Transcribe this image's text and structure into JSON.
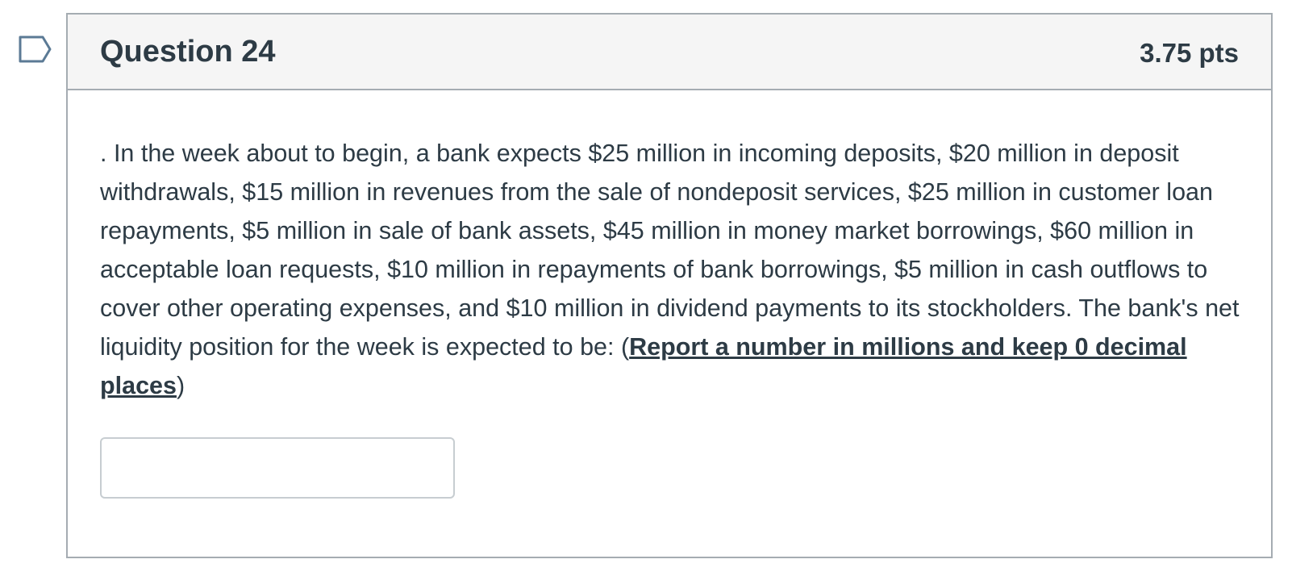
{
  "question": {
    "title": "Question 24",
    "points": "3.75 pts",
    "text_before": ". In the week about to begin, a bank expects $25 million in incoming deposits, $20 million in deposit withdrawals, $15 million in revenues from the sale of nondeposit services, $25 million in customer loan repayments, $5 million in sale of bank assets, $45 million in money market borrowings, $60 million in acceptable loan requests, $10 million in repayments of bank borrowings, $5 million in cash outflows to cover other operating expenses, and $10 million in dividend payments to its stockholders. The bank's net liquidity position for the week is expected to be: (",
    "instruction_link": "Report a number in millions and keep 0 decimal places",
    "text_after": ")",
    "answer_value": "",
    "flag_icon": "flag-question-icon"
  },
  "colors": {
    "text": "#2d3b45",
    "border": "#a5acb2",
    "header_bg": "#f5f5f5",
    "flag_stroke": "#5b7a95"
  }
}
